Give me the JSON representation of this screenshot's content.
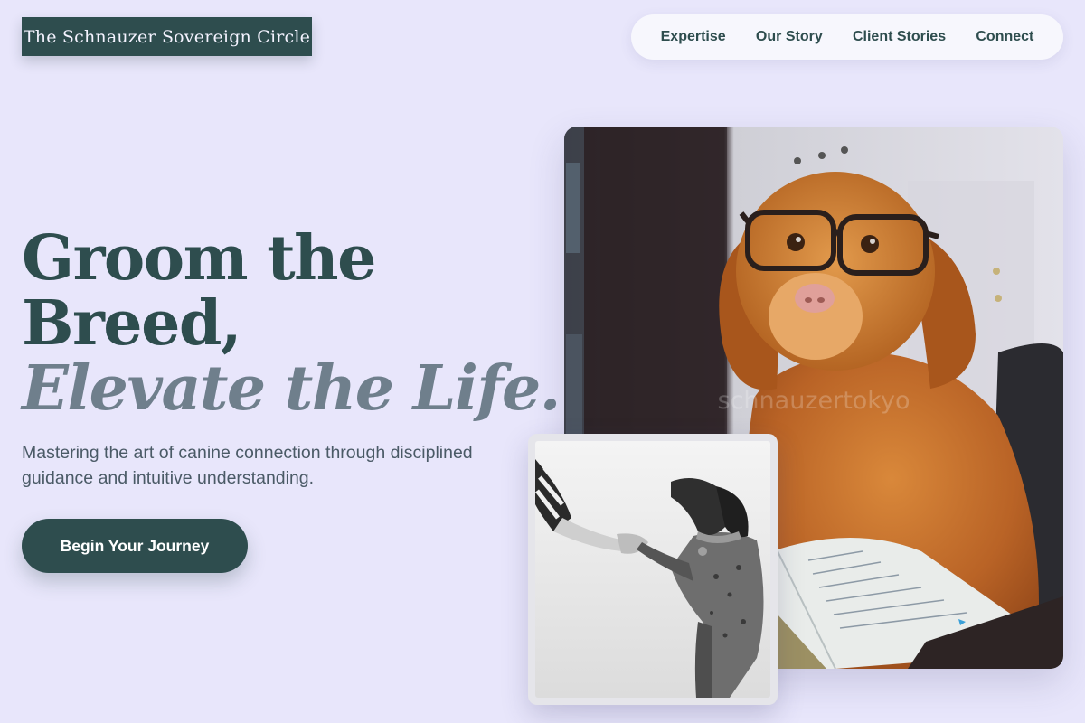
{
  "brand": {
    "name": "The Schnauzer Sovereign Circle"
  },
  "nav": {
    "items": [
      {
        "label": "Expertise"
      },
      {
        "label": "Our Story"
      },
      {
        "label": "Client Stories"
      },
      {
        "label": "Connect"
      }
    ]
  },
  "hero": {
    "headline_line1": "Groom the",
    "headline_line2": "Breed,",
    "headline_accent": "Elevate the Life.",
    "subtitle": "Mastering the art of canine connection through disciplined guidance and intuitive understanding.",
    "cta_label": "Begin Your Journey"
  },
  "images": {
    "main_watermark": "schnauzertokyo"
  },
  "colors": {
    "background": "#e8e6fb",
    "primary": "#2e4d4e",
    "accent_text": "#6f7f8c",
    "nav_background": "#f7f7fd"
  }
}
